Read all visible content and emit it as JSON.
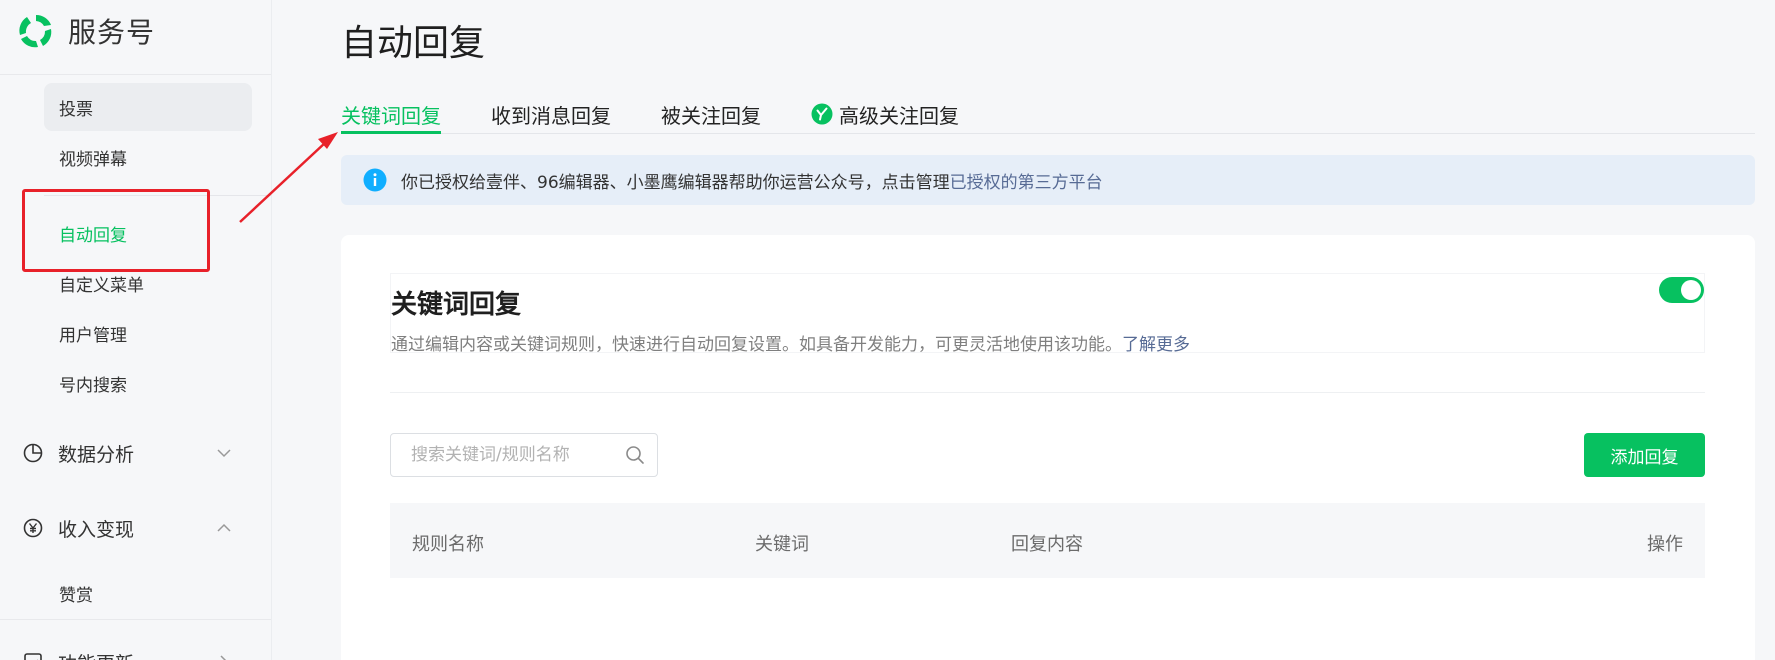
{
  "brand": {
    "name": "服务号",
    "logo_icon": "wechat-service-logo",
    "color": "#07c160"
  },
  "sidebar": {
    "items": [
      {
        "label": "投票",
        "state": "hover"
      },
      {
        "label": "视频弹幕",
        "state": "normal"
      },
      {
        "label": "自动回复",
        "state": "active"
      },
      {
        "label": "自定义菜单",
        "state": "normal"
      },
      {
        "label": "用户管理",
        "state": "normal"
      },
      {
        "label": "号内搜索",
        "state": "normal"
      }
    ],
    "groups": [
      {
        "label": "数据分析",
        "icon": "pie-chart-icon",
        "expanded": false
      },
      {
        "label": "收入变现",
        "icon": "yuan-icon",
        "expanded": true,
        "children": [
          {
            "label": "赞赏"
          }
        ]
      },
      {
        "label": "功能更新",
        "icon": "feature-icon",
        "expanded": false
      }
    ]
  },
  "annotation": {
    "color": "#e8212a"
  },
  "page": {
    "title": "自动回复"
  },
  "tabs": [
    {
      "label": "关键词回复",
      "active": true
    },
    {
      "label": "收到消息回复",
      "active": false
    },
    {
      "label": "被关注回复",
      "active": false
    },
    {
      "label": "高级关注回复",
      "active": false,
      "badge_icon": "verified-badge-icon"
    }
  ],
  "notice": {
    "text": "你已授权给壹伴、96编辑器、小墨鹰编辑器帮助你运营公众号，点击管理",
    "link": "已授权的第三方平台"
  },
  "section": {
    "title": "关键词回复",
    "description": "通过编辑内容或关键词规则，快速进行自动回复设置。如具备开发能力，可更灵活地使用该功能。",
    "learn_more": "了解更多",
    "toggle_on": true
  },
  "search": {
    "placeholder": "搜索关键词/规则名称",
    "value": ""
  },
  "toolbar": {
    "add_label": "添加回复"
  },
  "table": {
    "columns": [
      "规则名称",
      "关键词",
      "回复内容",
      "操作"
    ]
  }
}
